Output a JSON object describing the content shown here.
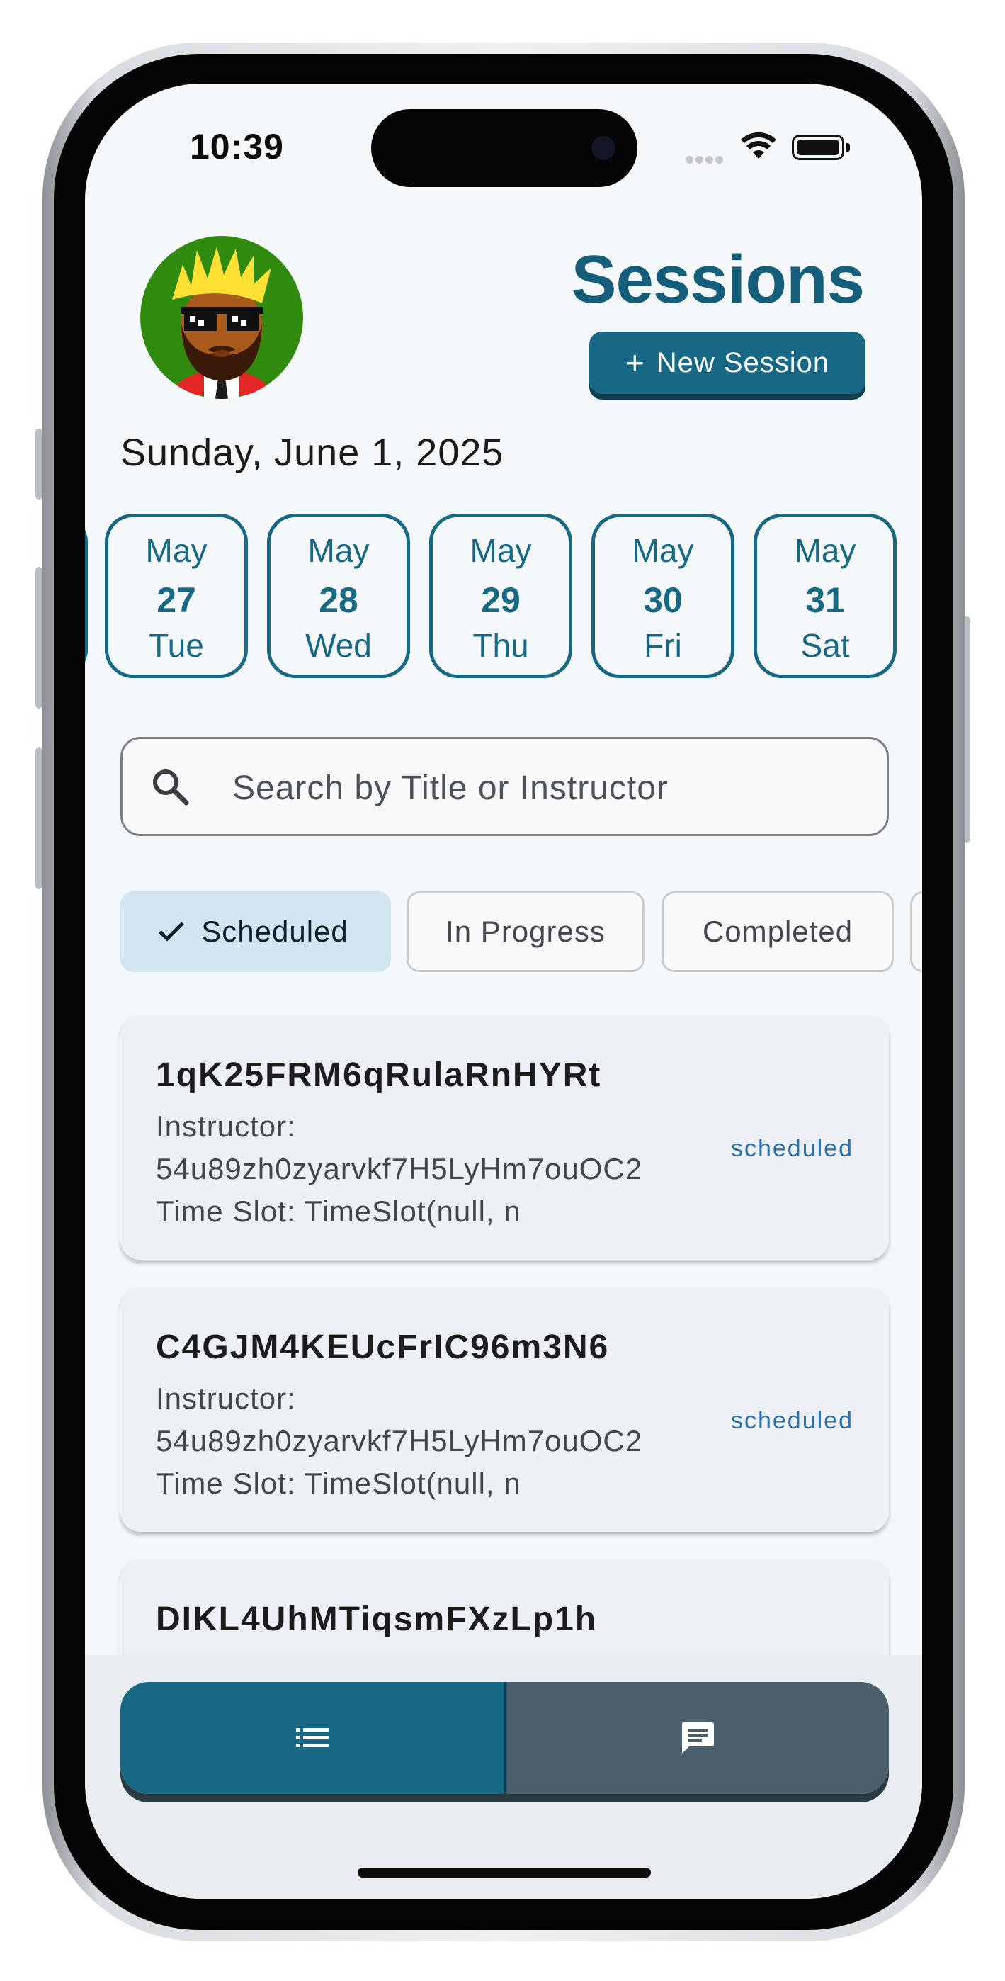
{
  "status_bar": {
    "time": "10:39"
  },
  "header": {
    "title": "Sessions",
    "new_session_label": "New Session",
    "date": "Sunday, June 1, 2025"
  },
  "day_strip": [
    {
      "month": "May",
      "day": "27",
      "weekday": "Tue"
    },
    {
      "month": "May",
      "day": "28",
      "weekday": "Wed"
    },
    {
      "month": "May",
      "day": "29",
      "weekday": "Thu"
    },
    {
      "month": "May",
      "day": "30",
      "weekday": "Fri"
    },
    {
      "month": "May",
      "day": "31",
      "weekday": "Sat"
    }
  ],
  "search": {
    "placeholder": "Search by Title or Instructor"
  },
  "filters": [
    {
      "label": "Scheduled",
      "selected": true
    },
    {
      "label": "In Progress",
      "selected": false
    },
    {
      "label": "Completed",
      "selected": false
    }
  ],
  "sessions": [
    {
      "title": "1qK25FRM6qRulaRnHYRt",
      "instructor_label": "Instructor:",
      "instructor": "54u89zh0zyarvkf7H5LyHm7ouOC2",
      "time_slot": "Time Slot: TimeSlot(null, n",
      "status": "scheduled"
    },
    {
      "title": "C4GJM4KEUcFrIC96m3N6",
      "instructor_label": "Instructor:",
      "instructor": "54u89zh0zyarvkf7H5LyHm7ouOC2",
      "time_slot": "Time Slot: TimeSlot(null, n",
      "status": "scheduled"
    },
    {
      "title": "DIKL4UhMTiqsmFXzLp1h",
      "instructor_label": "",
      "instructor": "",
      "time_slot": "",
      "status": ""
    }
  ],
  "bottom_nav": [
    {
      "icon": "list-icon",
      "active": true
    },
    {
      "icon": "chat-icon",
      "active": false
    }
  ],
  "colors": {
    "primary": "#166884",
    "title": "#145e7b",
    "chip_selected": "#d2e5f2",
    "status": "#2a72ad",
    "nav_inactive": "#4a5f6b"
  }
}
